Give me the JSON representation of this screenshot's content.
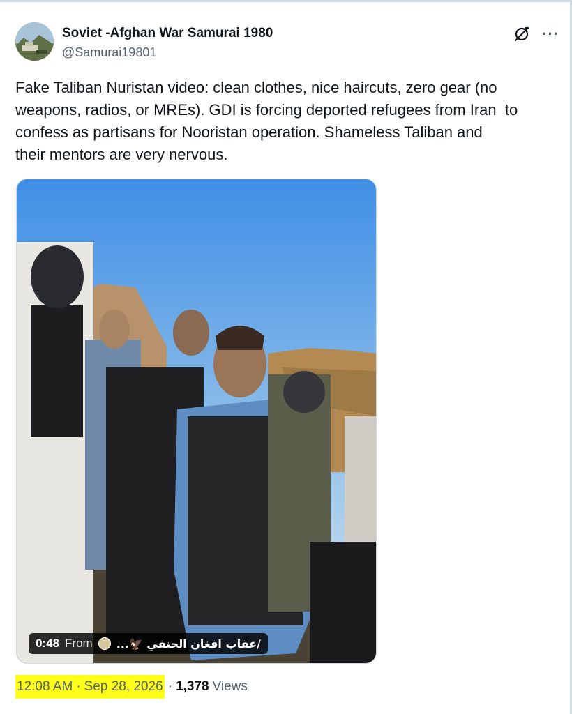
{
  "author": {
    "display_name": "Soviet -Afghan War Samurai 1980",
    "handle": "@Samurai19801"
  },
  "header_icons": [
    "grok-icon",
    "more-icon"
  ],
  "more_label": "···",
  "tweet": {
    "text": "Fake Taliban Nuristan video: clean clothes, nice haircuts, zero gear (no\nweapons, radios, or MREs). GDI is forcing deported refugees from Iran  to\nconfess as partisans for Nooristan operation. Shameless Taliban and\ntheir mentors are very nervous."
  },
  "video": {
    "duration": "0:48",
    "from_label": "From",
    "source_name": "/عقاب افغان الحنفي 🦅..."
  },
  "meta": {
    "time": "12:08 AM",
    "date_sep": "·",
    "date": "Sep 28, 2026",
    "views_sep": "·",
    "views_count": "1,378",
    "views_label": "Views"
  },
  "colors": {
    "text": "#0f1419",
    "secondary": "#536471",
    "highlight": "#ffff1a",
    "border": "#cfd9de"
  }
}
